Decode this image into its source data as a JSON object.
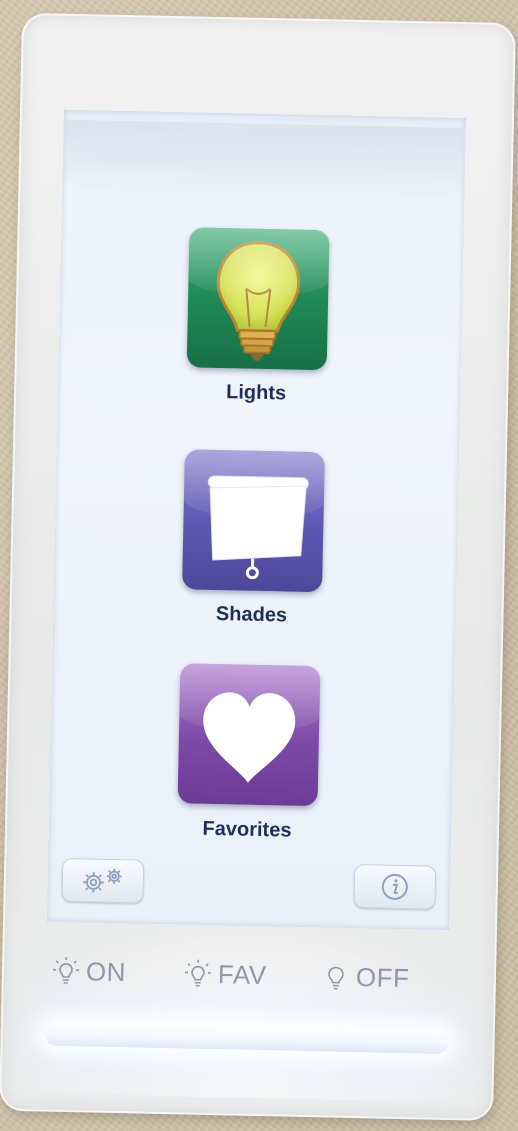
{
  "screen": {
    "tiles": [
      {
        "label": "Lights",
        "icon": "lightbulb-icon"
      },
      {
        "label": "Shades",
        "icon": "window-shade-icon"
      },
      {
        "label": "Favorites",
        "icon": "heart-icon"
      }
    ],
    "settings_icon": "gears-icon",
    "info_icon": "info-icon"
  },
  "hardware_buttons": [
    {
      "label": "ON",
      "icon": "bulb-glow-icon"
    },
    {
      "label": "FAV",
      "icon": "bulb-glow-icon"
    },
    {
      "label": "OFF",
      "icon": "bulb-outline-icon"
    }
  ],
  "colors": {
    "lights_tile": "#1f8a57",
    "shades_tile": "#5e57b1",
    "favorites_tile": "#7d4aa8",
    "label_text": "#1e2f58"
  }
}
